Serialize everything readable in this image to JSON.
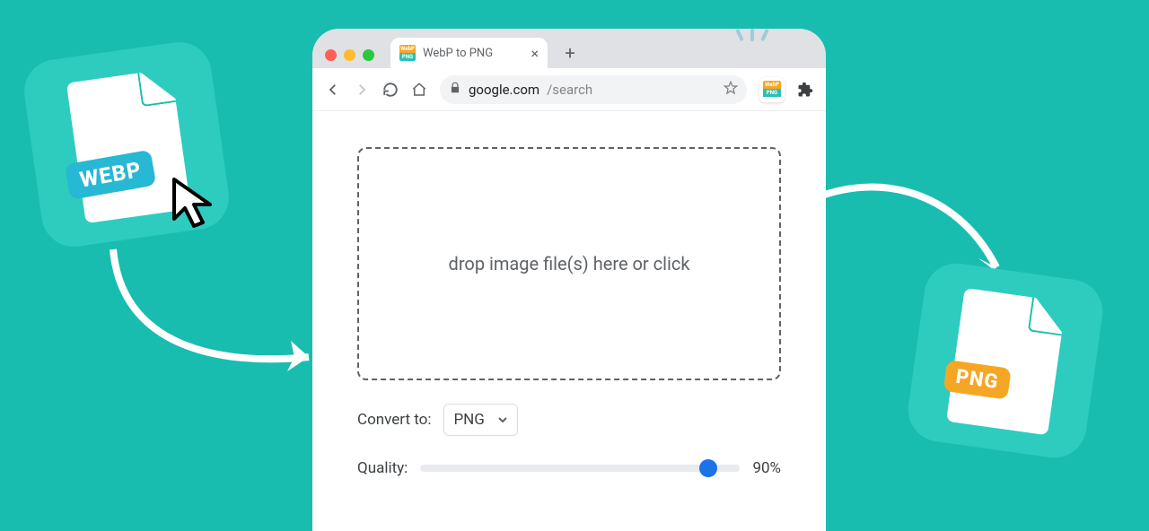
{
  "browser": {
    "tab_title": "WebP to PNG",
    "url_host": "google.com",
    "url_path": "/search",
    "favicon_top": "WebP",
    "favicon_bot": "PNG"
  },
  "dropzone": {
    "text": "drop image file(s) here or click"
  },
  "convert": {
    "label": "Convert to:",
    "selected": "PNG"
  },
  "quality": {
    "label": "Quality:",
    "value": 90,
    "display": "90%"
  },
  "left_card": {
    "badge": "WEBP"
  },
  "right_card": {
    "badge": "PNG"
  },
  "colors": {
    "bg": "#19bdb0",
    "card": "#2dccbf",
    "webp_badge": "#27b8d4",
    "png_badge": "#f5a623",
    "slider_thumb": "#1a73e8"
  }
}
